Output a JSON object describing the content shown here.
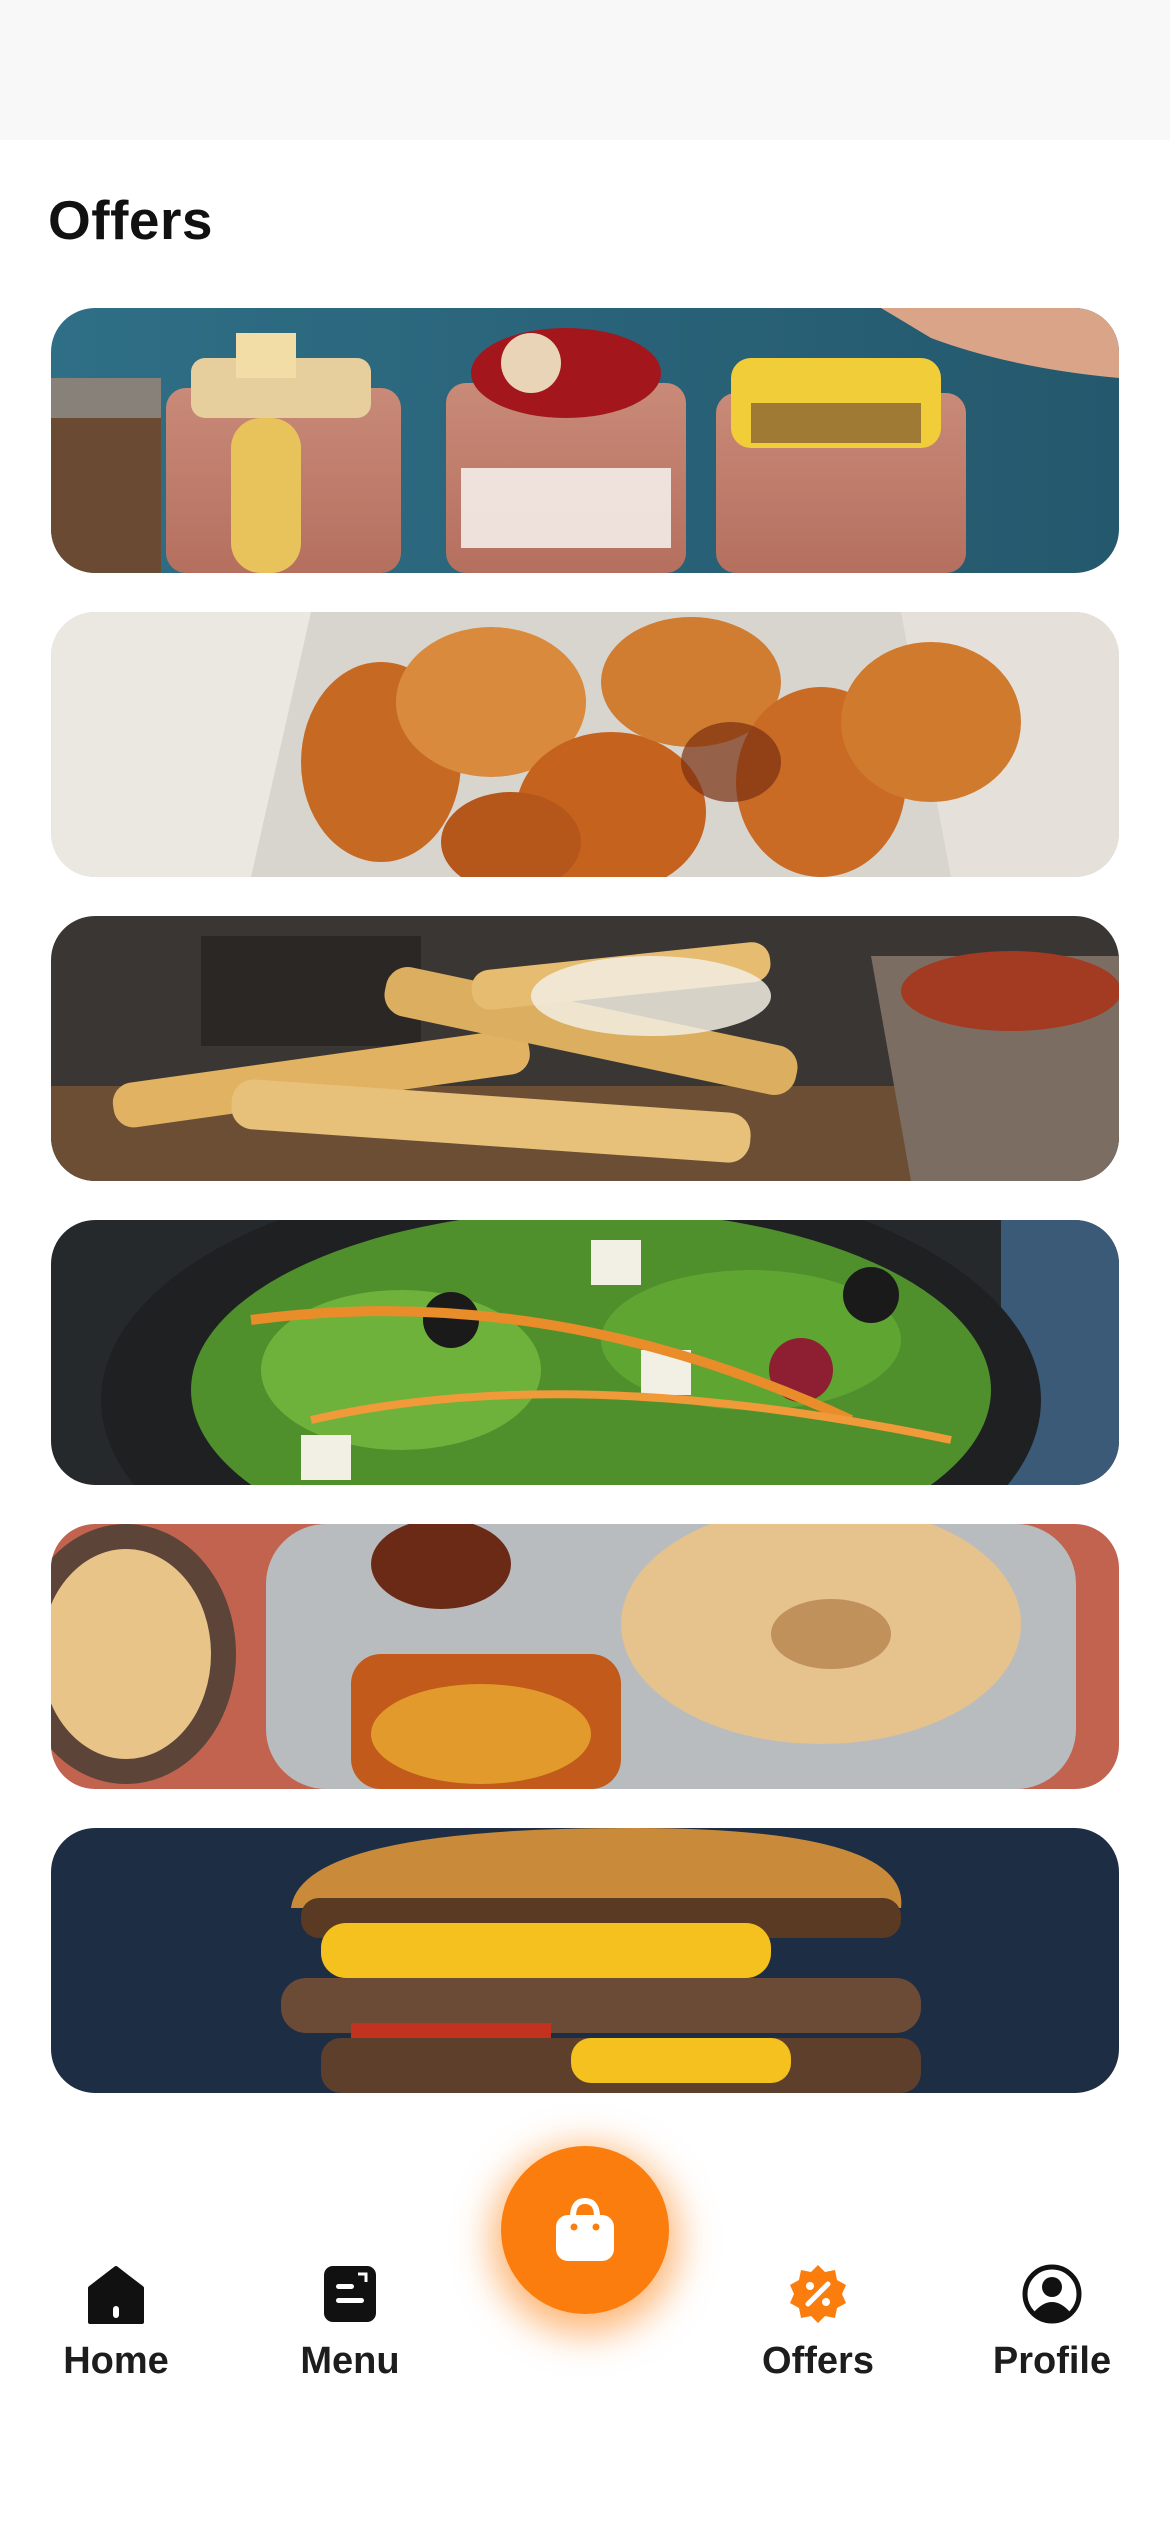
{
  "page": {
    "title": "Offers"
  },
  "offers": [
    {
      "image": "smoothie-cups-photo"
    },
    {
      "image": "chicken-wings-photo"
    },
    {
      "image": "parmesan-fries-photo"
    },
    {
      "image": "greek-salad-photo"
    },
    {
      "image": "indian-thali-photo"
    },
    {
      "image": "double-cheeseburger-photo"
    }
  ],
  "nav": {
    "items": [
      {
        "label": "Home",
        "icon": "home-icon"
      },
      {
        "label": "Menu",
        "icon": "menu-document-icon"
      },
      {
        "label": "Offers",
        "icon": "discount-badge-icon",
        "active": true
      },
      {
        "label": "Profile",
        "icon": "profile-icon"
      }
    ],
    "cart_icon": "shopping-bag-icon"
  },
  "colors": {
    "accent": "#fb7d0d",
    "text": "#1d1d1d",
    "statusbar": "#f8f8f8"
  }
}
